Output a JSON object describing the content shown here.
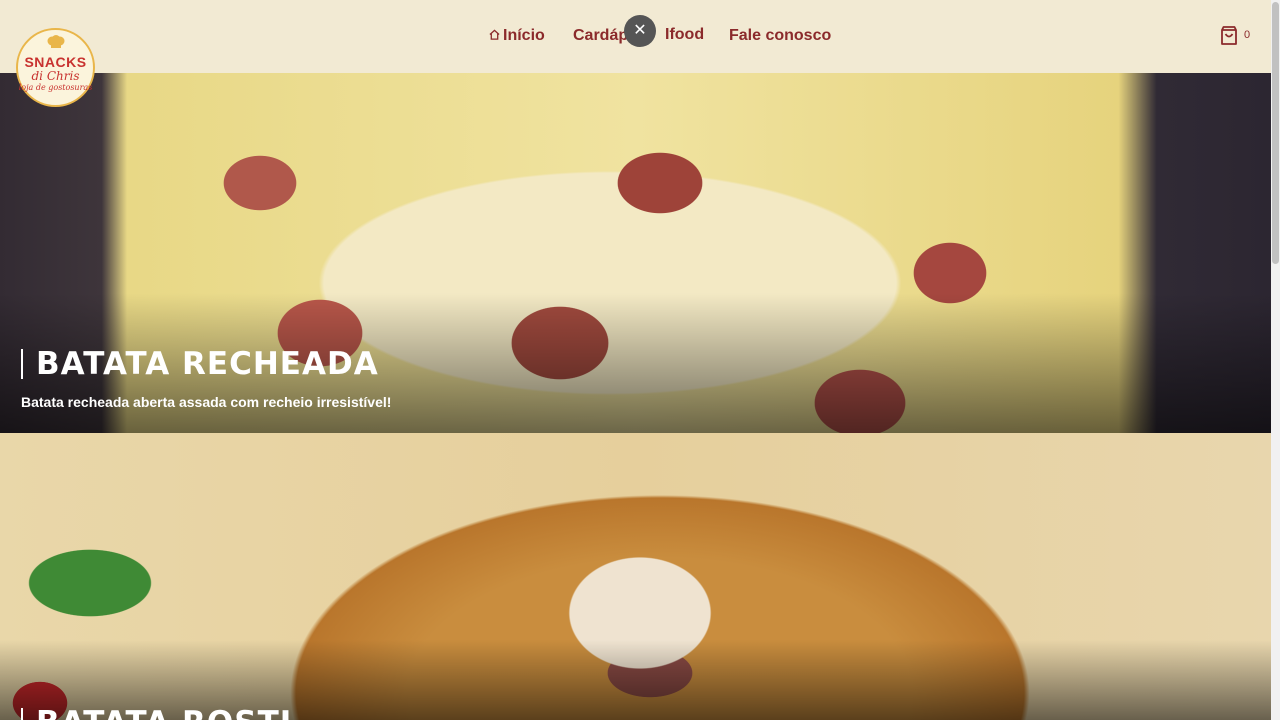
{
  "logo": {
    "line1": "SNACKS",
    "line2": "di Chris",
    "line3": "loja de gostosuras"
  },
  "nav": {
    "home": "Início",
    "menu": "Cardápio",
    "ifood": "Ifood",
    "contact": "Fale conosco"
  },
  "close_button": {
    "glyph": "✕"
  },
  "cart": {
    "count": "0",
    "icon": "shopping-bag-icon"
  },
  "products": [
    {
      "title": "BATATA RECHEADA",
      "subtitle": "Batata recheada aberta assada com recheio irresistível!"
    },
    {
      "title": "BATATA ROSTI"
    }
  ],
  "colors": {
    "header_bg": "#f2ead3",
    "nav_text": "#8b2a2b",
    "logo_accent": "#c8322f"
  }
}
